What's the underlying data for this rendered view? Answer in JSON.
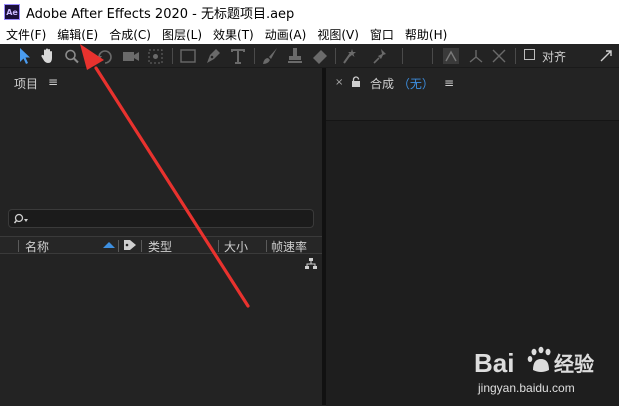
{
  "window": {
    "app_logo": "Ae",
    "title": "Adobe After Effects 2020 - 无标题项目.aep"
  },
  "menu": [
    "文件(F)",
    "编辑(E)",
    "合成(C)",
    "图层(L)",
    "效果(T)",
    "动画(A)",
    "视图(V)",
    "窗口",
    "帮助(H)"
  ],
  "toolbar": {
    "tools": [
      "selection-tool",
      "hand-tool",
      "zoom-tool",
      "rotate-tool",
      "camera-tool",
      "pan-behind-tool",
      "rectangle-tool",
      "pen-tool",
      "type-tool",
      "brush-tool",
      "clone-stamp-tool",
      "eraser-tool",
      "roto-brush-tool",
      "puppet-pin-tool"
    ],
    "align_label": "对齐"
  },
  "project_panel": {
    "tab_label": "项目",
    "menu_glyph": "≡",
    "search_placeholder": "",
    "columns": {
      "name": "名称",
      "type": "类型",
      "size": "大小",
      "framerate": "帧速率"
    }
  },
  "composition_panel": {
    "close_glyph": "×",
    "tab_label": "合成",
    "tab_value": "（无）",
    "menu_glyph": "≡"
  },
  "watermark": {
    "brand_a": "Bai",
    "brand_b": "经验",
    "url": "jingyan.baidu.com"
  },
  "colors": {
    "accent_blue": "#3d8fe0",
    "annotation_red": "#e8322e",
    "panel_bg": "#232323"
  }
}
